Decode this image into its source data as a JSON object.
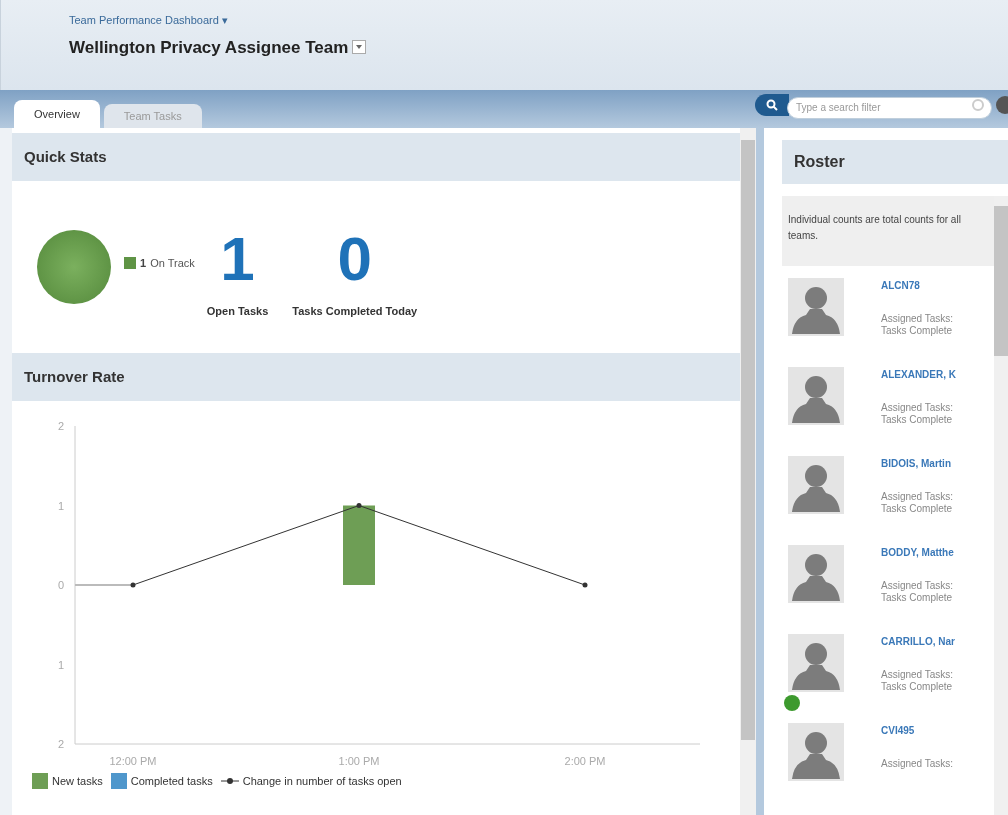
{
  "header": {
    "breadcrumb": "Team Performance Dashboard ▾",
    "title": "Wellington Privacy Assignee Team"
  },
  "tabs": [
    {
      "label": "Overview",
      "selected": true
    },
    {
      "label": "Team Tasks",
      "selected": false
    }
  ],
  "search": {
    "placeholder": "Type a search filter"
  },
  "quick_stats": {
    "title": "Quick Stats",
    "status": {
      "count": "1",
      "label": "On Track",
      "color": "#5f9445"
    },
    "stats": [
      {
        "value": "1",
        "label": "Open Tasks"
      },
      {
        "value": "0",
        "label": "Tasks Completed Today"
      }
    ]
  },
  "turnover": {
    "title": "Turnover Rate",
    "chart_data": {
      "type": "bar",
      "categories": [
        "12:00 PM",
        "1:00 PM",
        "2:00 PM"
      ],
      "ylim": [
        -2,
        2
      ],
      "legend": true,
      "ref_lines": [
        {
          "axis": "y",
          "value": 0
        }
      ],
      "yticks": [
        {
          "value": -2,
          "label": "2"
        },
        {
          "value": -1,
          "label": "1"
        },
        0,
        1,
        2
      ],
      "series": [
        {
          "name": "New tasks",
          "color": "#6e9e55",
          "values": [
            0,
            1,
            0
          ]
        },
        {
          "name": "Completed tasks",
          "color": "#4f97cc",
          "values": [
            0,
            0,
            0
          ]
        },
        {
          "name": "Change in number of tasks open",
          "color": "#333333",
          "type": "line",
          "values": [
            0,
            1,
            0
          ]
        }
      ]
    }
  },
  "roster": {
    "title": "Roster",
    "note": "Individual counts are total counts for all teams.",
    "members": [
      {
        "name": "ALCN78",
        "lines": [
          "Assigned Tasks:",
          "Tasks Complete"
        ],
        "online": false
      },
      {
        "name": "ALEXANDER, K",
        "lines": [
          "Assigned Tasks:",
          "Tasks Complete"
        ],
        "online": false
      },
      {
        "name": "BIDOIS, Martin",
        "lines": [
          "Assigned Tasks:",
          "Tasks Complete"
        ],
        "online": false
      },
      {
        "name": "BODDY, Matthe",
        "lines": [
          "Assigned Tasks:",
          "Tasks Complete"
        ],
        "online": false
      },
      {
        "name": "CARRILLO, Nar",
        "lines": [
          "Assigned Tasks:",
          "Tasks Complete"
        ],
        "online": true
      },
      {
        "name": "CVI495",
        "lines": [
          "Assigned Tasks:"
        ],
        "online": false
      }
    ]
  }
}
